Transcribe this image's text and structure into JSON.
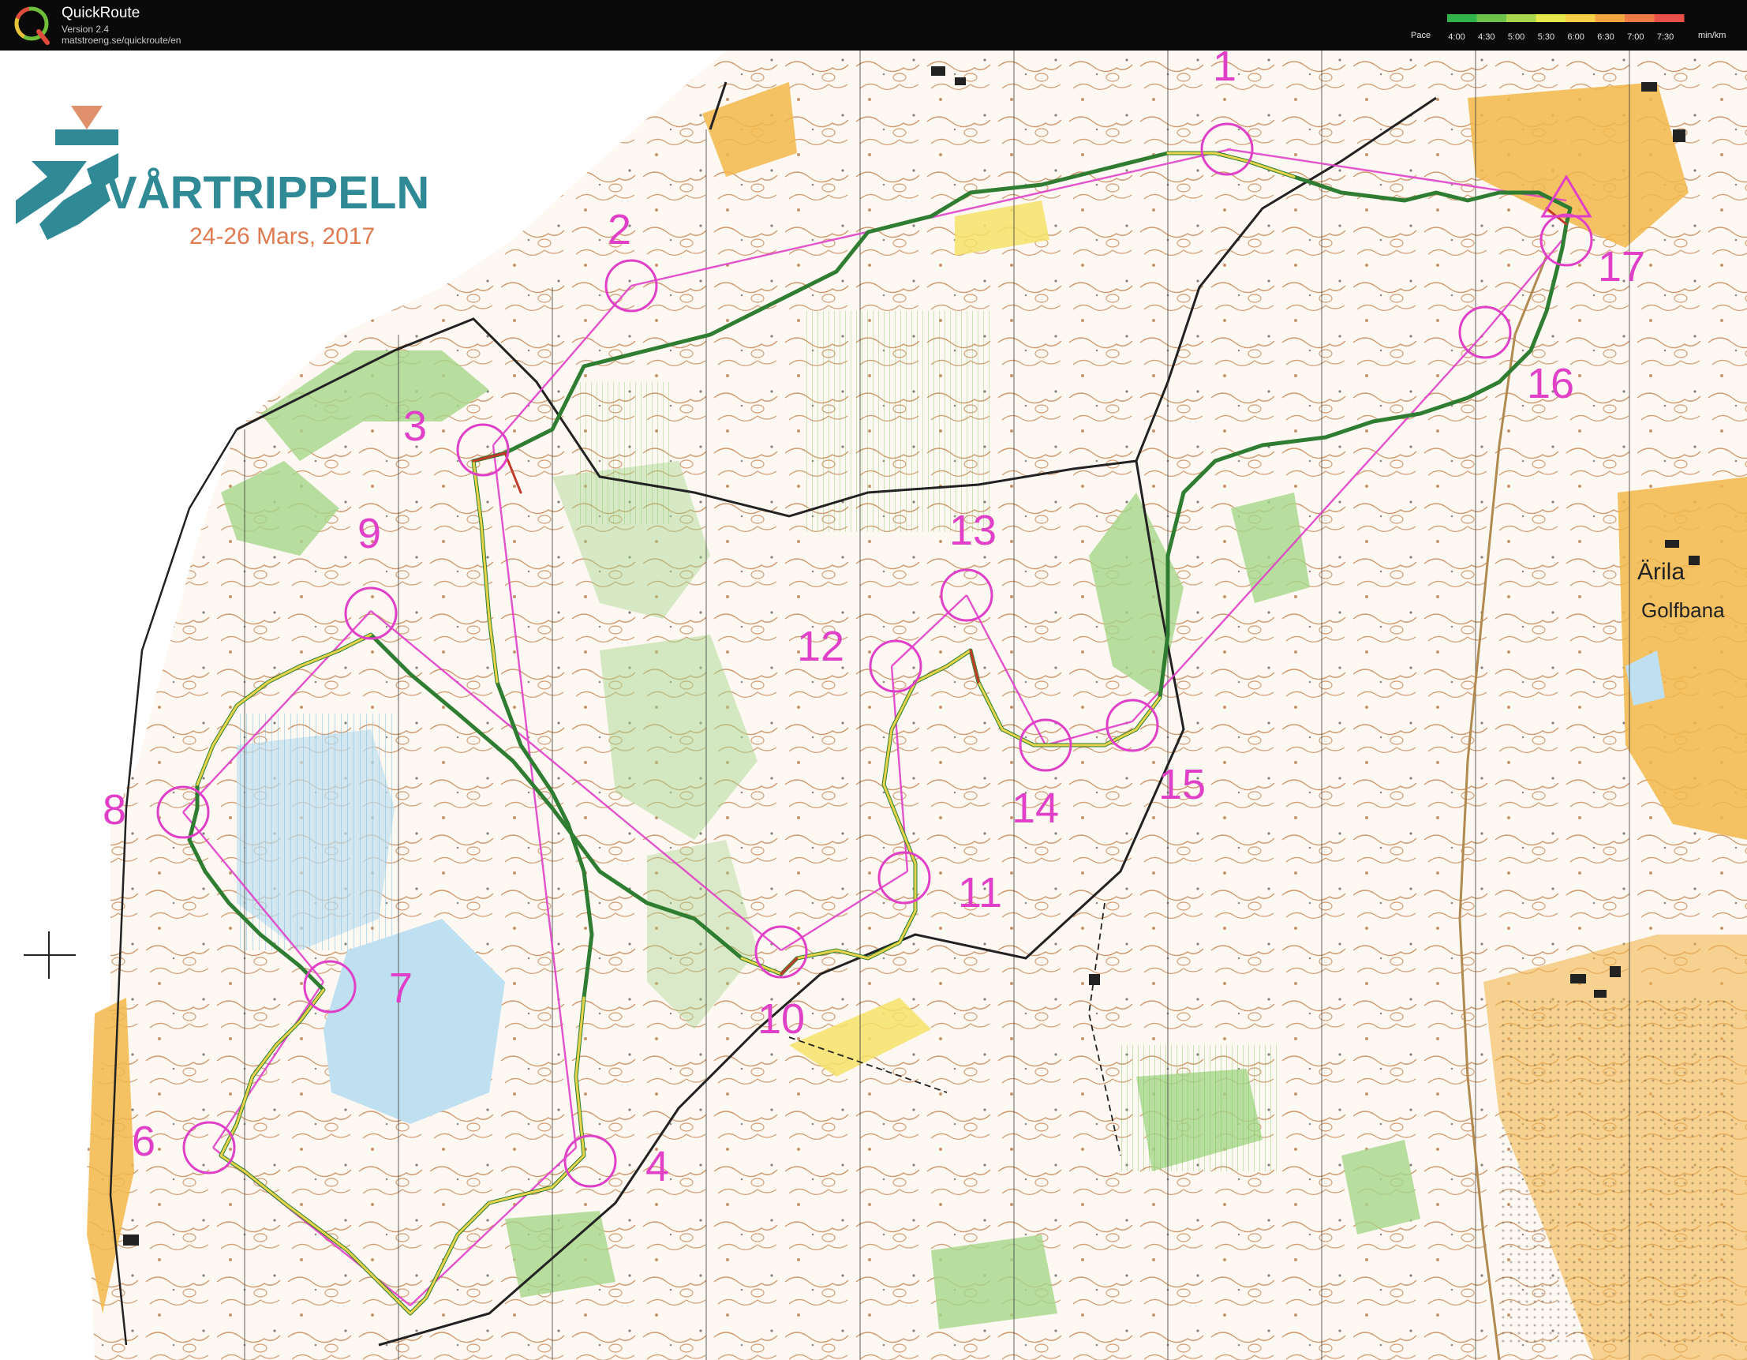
{
  "app": {
    "name": "QuickRoute",
    "version": "Version 2.4",
    "url": "matstroeng.se/quickroute/en"
  },
  "pace_legend": {
    "label": "Pace",
    "ticks": [
      "4:00",
      "4:30",
      "5:00",
      "5:30",
      "6:00",
      "6:30",
      "7:00",
      "7:30"
    ],
    "unit": "min/km",
    "colors": [
      "#2fb34a",
      "#6cc24a",
      "#a8d64c",
      "#e4e84a",
      "#f5cf45",
      "#f2a443",
      "#ee7a45",
      "#e8504a"
    ]
  },
  "event": {
    "title": "VÅRTRIPPELN",
    "dates": "24-26 Mars, 2017"
  },
  "map_labels": {
    "place": "Ärila",
    "golf": "Golfbana"
  },
  "controls": [
    "1",
    "2",
    "3",
    "4",
    "6",
    "7",
    "8",
    "9",
    "10",
    "11",
    "12",
    "13",
    "14",
    "15",
    "16",
    "17"
  ],
  "colors": {
    "course": "#e040c8",
    "route_fast": "#2e8b2e",
    "route_slow": "#e8d44a",
    "contour": "#b5703c",
    "vegetation": "#a5d68a",
    "open_land": "#f2b74a",
    "water": "#bfe0f0"
  }
}
